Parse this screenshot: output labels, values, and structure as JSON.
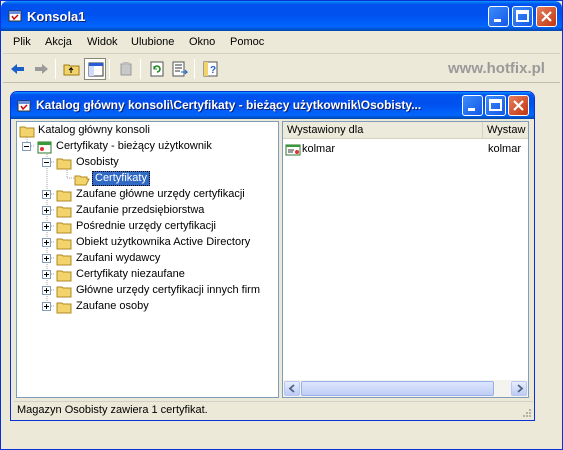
{
  "app": {
    "title": "Konsola1",
    "watermark": "www.hotfix.pl"
  },
  "menu": {
    "items": [
      "Plik",
      "Akcja",
      "Widok",
      "Ulubione",
      "Okno",
      "Pomoc"
    ]
  },
  "toolbar": {
    "buttons": [
      "back-arrow-icon",
      "forward-arrow-icon",
      "up-folder-icon",
      "show-hide-tree-icon",
      "delete-icon",
      "refresh-icon",
      "export-list-icon",
      "help-icon"
    ]
  },
  "inner_window": {
    "title": "Katalog główny konsoli\\Certyfikaty - bieżący użytkownik\\Osobisty..."
  },
  "tree": {
    "root": "Katalog główny konsoli",
    "certs_user": "Certyfikaty - bieżący użytkownik",
    "personal": "Osobisty",
    "certificates": "Certyfikaty",
    "children": [
      "Zaufane główne urzędy certyfikacji",
      "Zaufanie przedsiębiorstwa",
      "Pośrednie urzędy certyfikacji",
      "Obiekt użytkownika Active Directory",
      "Zaufani wydawcy",
      "Certyfikaty niezaufane",
      "Główne urzędy certyfikacji innych firm",
      "Zaufane osoby"
    ]
  },
  "list": {
    "columns": [
      "Wystawiony dla",
      "Wystaw"
    ],
    "rows": [
      {
        "issued_to": "kolmar",
        "issued_by": "kolmar"
      }
    ]
  },
  "status": {
    "text": "Magazyn Osobisty zawiera 1 certyfikat."
  },
  "colors": {
    "title_blue": "#0053ee",
    "selection": "#316ac5",
    "window_face": "#ece9d8",
    "close_red": "#c2350f"
  }
}
